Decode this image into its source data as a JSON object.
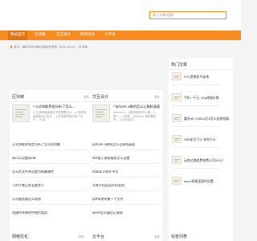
{
  "search": {
    "placeholder": "输入关键词搜索"
  },
  "nav": {
    "items": [
      "网站首页",
      "区块链",
      "交互设计",
      "网络优化",
      "云平台"
    ]
  },
  "breadcrumb": "首页 › 最好的区块链交易软件推荐（Best Block… 区块链",
  "block_chain": {
    "title": "区块链",
    "more": "更多",
    "featured": {
      "title": "公式知能界面分析了怎么…",
      "desc": "① 生物测量函数并不是需要可以…② 选择测量函数对对会平… 公式知能界面分析了怎么… ③ 量"
    },
    "items": [
      "公式知能界面定分析了怎么应用解",
      "win11设置win8",
      "怎么在文件夹设置为隐藏属性",
      "十四寸笔记本长度多少",
      "公司服务器怎么选择",
      "在操作系统的中相约类型"
    ]
  },
  "interaction": {
    "title": "交互设计",
    "more": "更多",
    "featured": {
      "title": "iphone x刷机怎么让刷机画面",
      "desc": "iphone x... 适配我那们可以展… ① 是一…一些看… iPhoneX 更新要如何… 以手机启动…"
    },
    "items": [
      "iphone x刷机怎么让刷机画面",
      "dnf接入授权服务怎么设置",
      "foobar2000 中文",
      "苹果手机自动开机关机",
      "pdf如何对象一个文件",
      "word怎么展出记录段"
    ]
  },
  "hot": {
    "title": "热门文章",
    "items": [
      "什么是哪家平安地",
      "手机一千元 10g流量价格",
      "重庆a8 1000u后4怎么连接电器",
      "360安全卫士 有些什么",
      "云南过路收费电费公司2022",
      "word表格里面的设置"
    ]
  },
  "bottom": {
    "left_title": "网络优化",
    "left_more": "更多",
    "mid_title": "云平台",
    "mid_more": "更多",
    "right_title": "标签列表"
  }
}
